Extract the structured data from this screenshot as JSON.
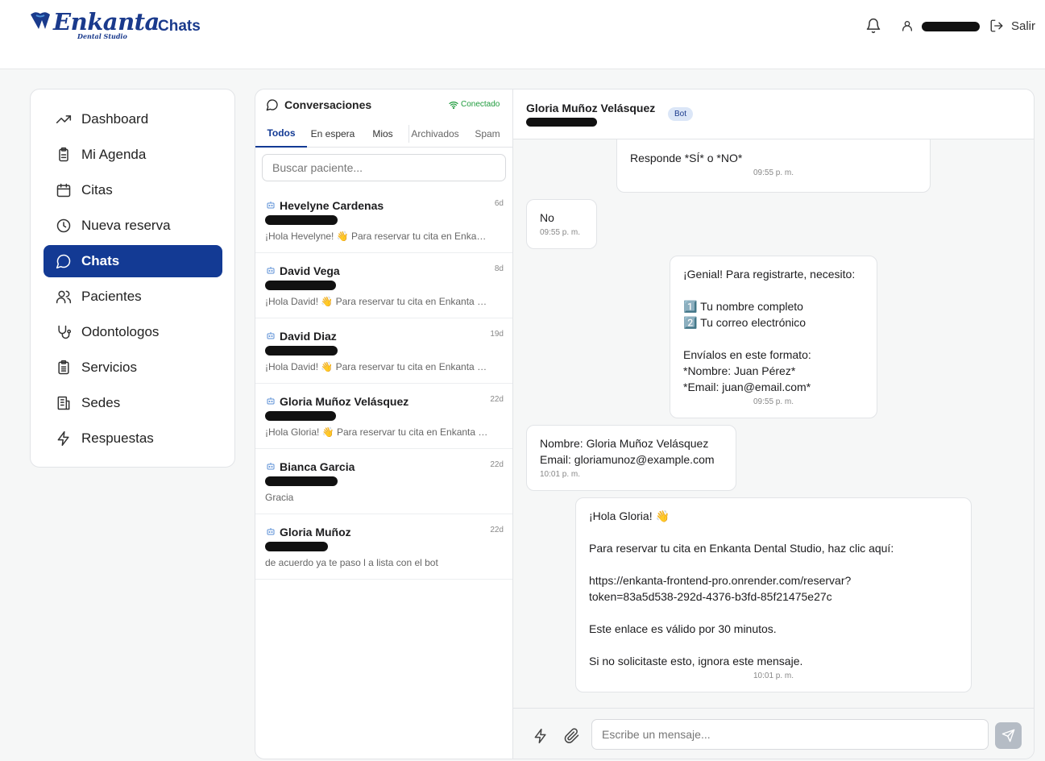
{
  "header": {
    "logo_text": "Enkanta",
    "logo_subtext": "Dental Studio",
    "page_title": "Chats",
    "logout_label": "Salir"
  },
  "sidebar": {
    "items": [
      {
        "label": "Dashboard",
        "icon": "trending-up-icon"
      },
      {
        "label": "Mi Agenda",
        "icon": "clipboard-icon"
      },
      {
        "label": "Citas",
        "icon": "calendar-icon"
      },
      {
        "label": "Nueva reserva",
        "icon": "clock-icon"
      },
      {
        "label": "Chats",
        "icon": "chat-bubble-icon",
        "active": true
      },
      {
        "label": "Pacientes",
        "icon": "users-icon"
      },
      {
        "label": "Odontologos",
        "icon": "stethoscope-icon"
      },
      {
        "label": "Servicios",
        "icon": "clipboard-list-icon"
      },
      {
        "label": "Sedes",
        "icon": "building-icon"
      },
      {
        "label": "Respuestas",
        "icon": "zap-icon"
      }
    ]
  },
  "conversations": {
    "title": "Conversaciones",
    "status": "Conectado",
    "tabs": [
      "Todos",
      "En espera",
      "Mios",
      "Archivados",
      "Spam"
    ],
    "search_placeholder": "Buscar paciente...",
    "items": [
      {
        "name": "Hevelyne Cardenas",
        "time": "6d",
        "preview": "¡Hola Hevelyne! 👋 Para reservar tu cita en Enkanta Dental Studio"
      },
      {
        "name": "David Vega",
        "time": "8d",
        "preview": "¡Hola David! 👋 Para reservar tu cita en Enkanta Dental Studio"
      },
      {
        "name": "David Diaz",
        "time": "19d",
        "preview": "¡Hola David! 👋 Para reservar tu cita en Enkanta Dental Studio"
      },
      {
        "name": "Gloria Muñoz Velásquez",
        "time": "22d",
        "preview": "¡Hola Gloria! 👋 Para reservar tu cita en Enkanta Dental Studio"
      },
      {
        "name": "Bianca Garcia",
        "time": "22d",
        "preview": "Gracia"
      },
      {
        "name": "Gloria Muñoz",
        "time": "22d",
        "preview": "de acuerdo ya te paso l a lista con el bot"
      }
    ]
  },
  "chat": {
    "contact_name": "Gloria Muñoz Velásquez",
    "badge": "Bot",
    "messages": [
      {
        "text": "Responde *SÍ* o *NO*",
        "time": "09:55 p. m."
      },
      {
        "text": "No",
        "time": "09:55 p. m."
      },
      {
        "text": "¡Genial! Para registrarte, necesito:\n\n1️⃣ Tu nombre completo\n2️⃣ Tu correo electrónico\n\nEnvíalos en este formato:\n*Nombre: Juan Pérez*\n*Email: juan@email.com*",
        "time": "09:55 p. m."
      },
      {
        "text": "Nombre: Gloria Muñoz Velásquez\nEmail: gloriamunoz@example.com",
        "time": "10:01 p. m."
      },
      {
        "text": "¡Hola Gloria! 👋\n\nPara reservar tu cita en Enkanta Dental Studio, haz clic aquí:\n\nhttps://enkanta-frontend-pro.onrender.com/reservar?\ntoken=83a5d538-292d-4376-b3fd-85f21475e27c\n\nEste enlace es válido por 30 minutos.\n\nSi no solicitaste esto, ignora este mensaje.",
        "time": "10:01 p. m."
      }
    ],
    "input_placeholder": "Escribe un mensaje..."
  },
  "colors": {
    "brand": "#133a94",
    "status_green": "#1f9b3d"
  }
}
